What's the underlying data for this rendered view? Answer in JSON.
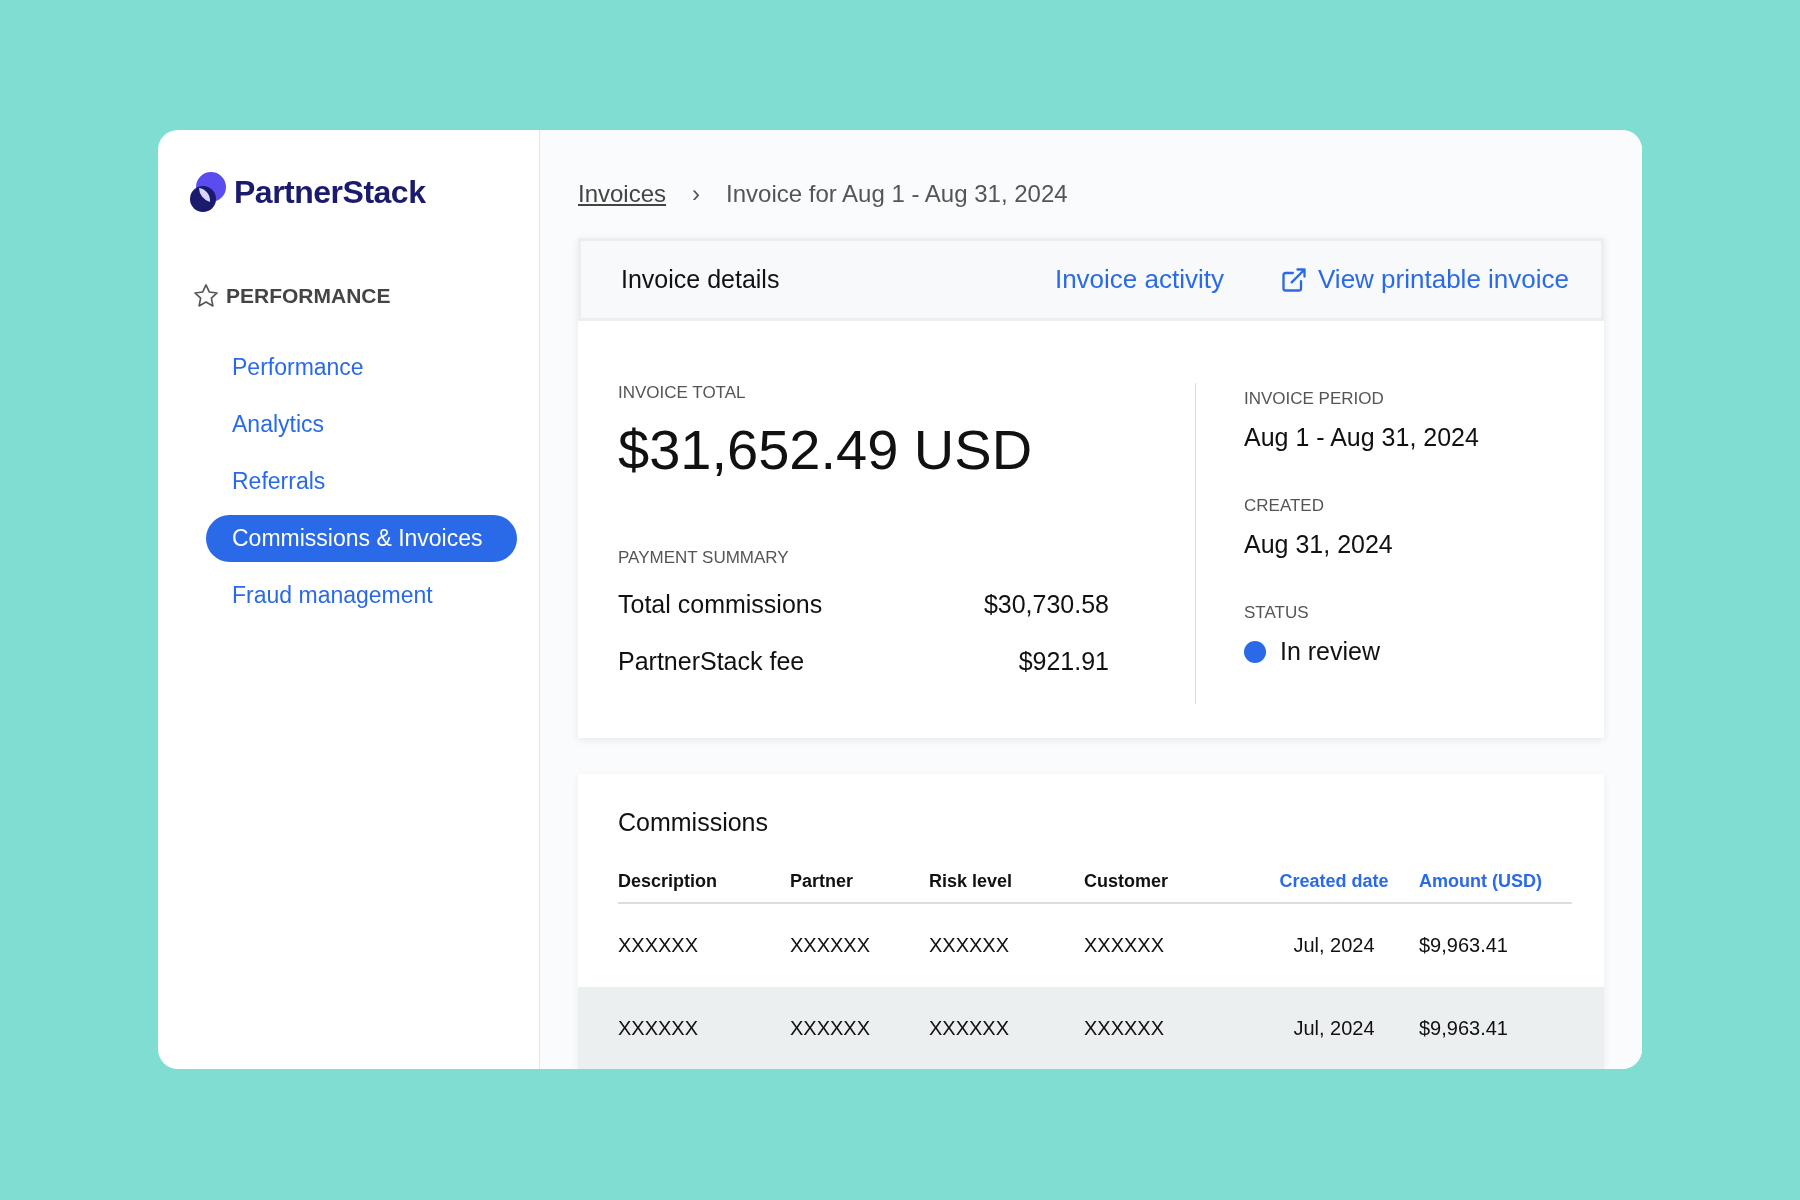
{
  "sidebar": {
    "logo": "PartnerStack",
    "section": "PERFORMANCE",
    "items": [
      {
        "label": "Performance",
        "selected": false
      },
      {
        "label": "Analytics",
        "selected": false
      },
      {
        "label": "Referrals",
        "selected": false
      },
      {
        "label": "Commissions & Invoices",
        "selected": true
      },
      {
        "label": "Fraud management",
        "selected": false
      }
    ]
  },
  "breadcrumb": {
    "parent": "Invoices",
    "separator": "›",
    "current": "Invoice for Aug 1 - Aug 31, 2024"
  },
  "details": {
    "title": "Invoice details",
    "links": [
      {
        "label": "Invoice activity",
        "kind": "plain"
      },
      {
        "label": "View printable invoice",
        "kind": "external"
      }
    ],
    "total_label": "INVOICE TOTAL",
    "total": "$31,652.49 USD",
    "summary_label": "PAYMENT SUMMARY",
    "summary": [
      {
        "label": "Total commissions",
        "value": "$30,730.58"
      },
      {
        "label": "PartnerStack fee",
        "value": "$921.91"
      }
    ],
    "period_label": "INVOICE PERIOD",
    "period": "Aug 1 - Aug 31, 2024",
    "created_label": "CREATED",
    "created": "Aug 31, 2024",
    "status_label": "STATUS",
    "status": {
      "label": "In review",
      "color": "#2a6ae9"
    }
  },
  "commissions": {
    "title": "Commissions",
    "columns": [
      {
        "label": "Description",
        "sortable": false
      },
      {
        "label": "Partner",
        "sortable": false
      },
      {
        "label": "Risk level",
        "sortable": false
      },
      {
        "label": "Customer",
        "sortable": false
      },
      {
        "label": "Created date",
        "sortable": true
      },
      {
        "label": "Amount (USD)",
        "sortable": true
      }
    ],
    "rows": [
      {
        "cells": [
          "XXXXXX",
          "XXXXXX",
          "XXXXXX",
          "XXXXXX",
          "Jul, 2024",
          "$9,963.41"
        ],
        "highlighted": false
      },
      {
        "cells": [
          "XXXXXX",
          "XXXXXX",
          "XXXXXX",
          "XXXXXX",
          "Jul, 2024",
          "$9,963.41"
        ],
        "highlighted": true
      }
    ]
  }
}
